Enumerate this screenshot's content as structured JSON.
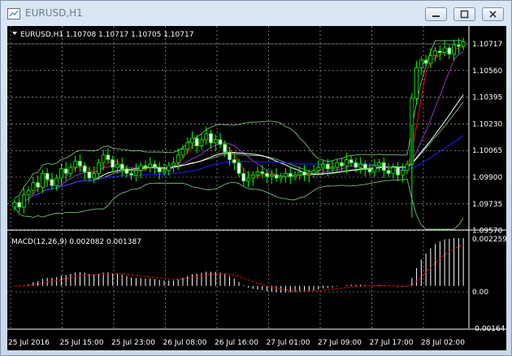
{
  "window": {
    "title": "EURUSD,H1"
  },
  "chart": {
    "header": "EURUSD,H1  1.10708 1.10717 1.10705 1.10717",
    "indicator_header": "MACD(12,26,9) 0.002082 0.001387",
    "price_labels": [
      "1.10717",
      "1.10560",
      "1.10395",
      "1.10230",
      "1.10065",
      "1.09900",
      "1.09735",
      "1.09570"
    ],
    "macd_labels": [
      "0.002259",
      "0.00",
      "-0.00164"
    ],
    "time_labels": [
      "25 Jul 2016",
      "25 Jul 15:00",
      "25 Jul 23:00",
      "26 Jul 08:00",
      "26 Jul 16:00",
      "27 Jul 01:00",
      "27 Jul 09:00",
      "27 Jul 17:00",
      "28 Jul 02:00"
    ],
    "colors": {
      "background": "#000000",
      "grid": "#c0c0c0",
      "bull": "#00ff00",
      "bear": "#ffffff",
      "ma_fast": "#ff0000",
      "ma_mid": "#9932cc",
      "ma_slow": "#1e1eff",
      "ma_white": "#ffffff",
      "bollinger": "#7fd37f",
      "macd_signal": "#ff0000"
    }
  },
  "chart_data": {
    "type": "candlestick",
    "symbol": "EURUSD",
    "timeframe": "H1",
    "last": {
      "open": 1.10708,
      "high": 1.10717,
      "low": 1.10705,
      "close": 1.10717
    },
    "ylim": [
      1.0957,
      1.10717
    ],
    "x": [
      "25 Jul 2016",
      "25 Jul 15:00",
      "25 Jul 23:00",
      "26 Jul 08:00",
      "26 Jul 16:00",
      "27 Jul 01:00",
      "27 Jul 09:00",
      "27 Jul 17:00",
      "28 Jul 02:00"
    ],
    "close": [
      1.0967,
      1.0964,
      1.0972,
      1.0975,
      1.098,
      1.0977,
      1.0986,
      1.0982,
      1.0978,
      1.0983,
      1.0989,
      1.0986,
      1.099,
      1.0994,
      1.0991,
      1.0987,
      1.0983,
      1.0986,
      1.0993,
      1.0998,
      1.0995,
      1.099,
      1.0992,
      1.0989,
      1.0986,
      1.0985,
      1.0988,
      1.0991,
      1.099,
      1.0992,
      1.099,
      1.0987,
      1.0988,
      1.0991,
      1.0993,
      1.0998,
      1.1002,
      1.1006,
      1.1009,
      1.1004,
      1.1008,
      1.1012,
      1.1006,
      1.1008,
      1.1005,
      1.1,
      1.0995,
      1.0993,
      1.0986,
      1.0981,
      1.0983,
      1.0985,
      1.0987,
      1.0986,
      1.0984,
      1.0985,
      1.0983,
      1.0984,
      1.0986,
      1.0984,
      1.0985,
      1.0987,
      1.0985,
      1.0986,
      1.0988,
      1.099,
      1.0992,
      1.0989,
      1.099,
      1.0993,
      1.0991,
      1.0995,
      1.0993,
      1.099,
      1.0992,
      1.0989,
      1.0987,
      1.0991,
      1.0993,
      1.0988,
      1.0986,
      1.099,
      1.0985,
      1.0988,
      1.0992,
      1.1035,
      1.1055,
      1.106,
      1.1058,
      1.1063,
      1.1066,
      1.1065,
      1.1068,
      1.1064,
      1.107,
      1.1069,
      1.1072
    ],
    "macd_ylim": [
      -0.00164,
      0.002259
    ],
    "macd_main_last": 0.002082,
    "macd_signal_last": 0.001387
  }
}
